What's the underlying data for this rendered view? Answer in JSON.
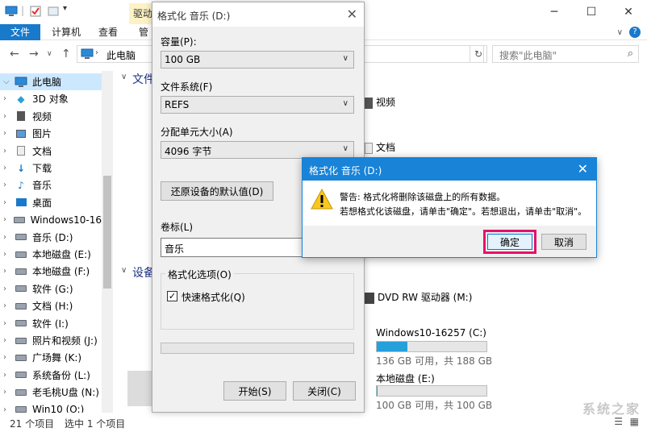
{
  "explorer": {
    "ribbon": {
      "drive_tools": "驱动",
      "tabs": [
        {
          "label": "文件"
        },
        {
          "label": "计算机"
        },
        {
          "label": "查看"
        },
        {
          "label": "管"
        }
      ]
    },
    "address": "此电脑",
    "search_placeholder": "搜索\"此电脑\"",
    "nav": [
      {
        "label": "此电脑",
        "icon": "computer-icon",
        "selected": true
      },
      {
        "label": "3D 对象",
        "icon": "cube-icon"
      },
      {
        "label": "视频",
        "icon": "video-icon"
      },
      {
        "label": "图片",
        "icon": "picture-icon"
      },
      {
        "label": "文档",
        "icon": "document-icon"
      },
      {
        "label": "下载",
        "icon": "download-icon"
      },
      {
        "label": "音乐",
        "icon": "music-icon"
      },
      {
        "label": "桌面",
        "icon": "desktop-icon"
      },
      {
        "label": "Windows10-16",
        "icon": "drive-icon"
      },
      {
        "label": "音乐 (D:)",
        "icon": "drive-icon"
      },
      {
        "label": "本地磁盘 (E:)",
        "icon": "drive-icon"
      },
      {
        "label": "本地磁盘 (F:)",
        "icon": "drive-icon"
      },
      {
        "label": "软件 (G:)",
        "icon": "drive-icon"
      },
      {
        "label": "文档 (H:)",
        "icon": "drive-icon"
      },
      {
        "label": "软件  (I:)",
        "icon": "drive-icon"
      },
      {
        "label": "照片和视频 (J:)",
        "icon": "drive-icon"
      },
      {
        "label": "广场舞 (K:)",
        "icon": "drive-icon"
      },
      {
        "label": "系统备份 (L:)",
        "icon": "drive-icon"
      },
      {
        "label": "老毛桃U盘 (N:)",
        "icon": "drive-icon"
      },
      {
        "label": "Win10 (O:)",
        "icon": "drive-icon"
      }
    ],
    "content": {
      "section_folders": "文件",
      "section_devices": "设备",
      "items": {
        "video": "视频",
        "docs": "文档",
        "dvd": "DVD RW 驱动器 (M:)",
        "win_drive": "Windows10-16257 (C:)",
        "win_space": "136 GB 可用，共 188 GB",
        "win_usage": 0.28,
        "local_drive": "本地磁盘 (E:)",
        "local_space": "100 GB 可用，共 100 GB",
        "local_usage": 0.01
      }
    },
    "status": {
      "count": "21 个项目",
      "selected": "选中 1 个项目"
    }
  },
  "format_dialog": {
    "title": "格式化 音乐 (D:)",
    "capacity_label": "容量(P):",
    "capacity_value": "100 GB",
    "fs_label": "文件系统(F)",
    "fs_value": "REFS",
    "alloc_label": "分配单元大小(A)",
    "alloc_value": "4096 字节",
    "restore_button": "还原设备的默认值(D)",
    "volume_label": "卷标(L)",
    "volume_value": "音乐",
    "options_label": "格式化选项(O)",
    "quick_format_label": "快速格式化(Q)",
    "start_button": "开始(S)",
    "close_button": "关闭(C)"
  },
  "warning_dialog": {
    "title": "格式化 音乐 (D:)",
    "line1": "警告: 格式化将删除该磁盘上的所有数据。",
    "line2": "若想格式化该磁盘，请单击\"确定\"。若想退出，请单击\"取消\"。",
    "ok_button": "确定",
    "cancel_button": "取消"
  },
  "watermark": "系统之家",
  "colors": {
    "accent": "#1979ca",
    "dialog_title": "#1883d7",
    "highlight": "#e4126b",
    "usage_bar": "#26a0da"
  }
}
